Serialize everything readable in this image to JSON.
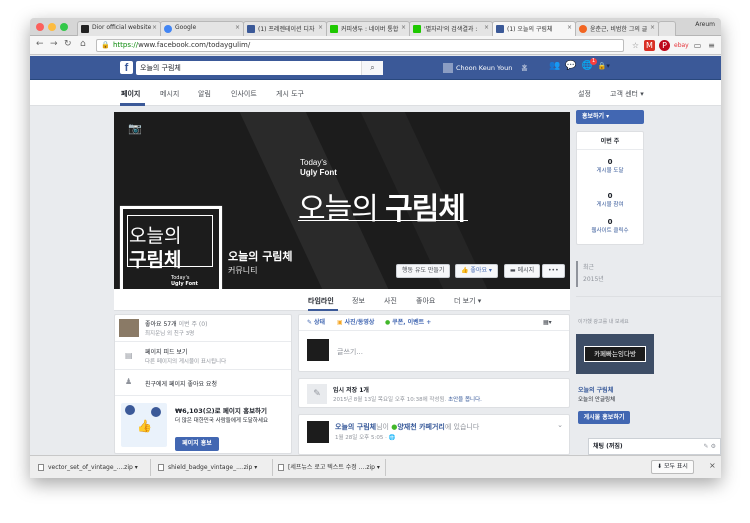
{
  "browser": {
    "tabs": [
      {
        "label": "Dior official website",
        "color": "#222222"
      },
      {
        "label": "Google",
        "color": "#4285f4"
      },
      {
        "label": "(1) 프레젠테이션 디자",
        "color": "#3b5998"
      },
      {
        "label": "커피생두 : 네이버 통합",
        "color": "#1ec800"
      },
      {
        "label": "'별자리'의 검색결과 :",
        "color": "#1ec800"
      },
      {
        "label": "(1) 오늘의 구림체",
        "color": "#3b5998"
      },
      {
        "label": "윤춘근, 비범한 그의 글",
        "color": "#f26522"
      }
    ],
    "profile_name": "Areum",
    "url_scheme": "https://",
    "url_rest": "www.facebook.com/todaygulim/"
  },
  "fb_header": {
    "search_value": "오늘의 구림체",
    "user_name": "Choon Keun Youn",
    "home_label": "홈",
    "notification_count": "1"
  },
  "page_nav": {
    "items": [
      "페이지",
      "메시지",
      "알림",
      "인사이트",
      "게시 도구"
    ],
    "settings": "설정",
    "help": "고객 센터 ▾"
  },
  "cover": {
    "today_line1": "Today's",
    "today_line2": "Ugly Font",
    "title_thin": "오늘의 ",
    "title_bold": "구림체",
    "profile_line1": "오늘의",
    "profile_line2": "구림체",
    "profile_small1": "Today's",
    "profile_small2": "Ugly Font",
    "page_name": "오늘의 구림체",
    "page_category": "커뮤니티",
    "btn_action": "행동 유도 만들기",
    "btn_like": "좋아요 ▾",
    "btn_message": "메시지",
    "btn_more": "•••"
  },
  "timeline_tabs": [
    "타임라인",
    "정보",
    "사진",
    "좋아요",
    "더 보기 ▾"
  ],
  "left_col": {
    "likes_text": "좋아요 57개",
    "likes_week": "이번 주 (0)",
    "likes_sub": "최지운님 외 친구 3명",
    "feed_title": "페이지 피드 보기",
    "feed_sub": "다른 페이지의 게시물이 표시됩니다",
    "invite": "친구에게 페이지 좋아요 요청",
    "promo_title": "₩6,103(으)로 페이지 홍보하기",
    "promo_sub": "더 많은 대한민국 사람들에게 도달하세요",
    "promo_btn": "페이지 홍보"
  },
  "composer": {
    "tab_status": "상태",
    "tab_photo": "사진/동영상",
    "tab_coupon": "쿠폰, 이벤트 +",
    "placeholder": "글쓰기..."
  },
  "draft": {
    "title": "임시 저장 1개",
    "sub_a": "2015년 8월 13일 목요일 오후 10:38에 작성됨.",
    "sub_link": "초안을 봅니다."
  },
  "post": {
    "name": "오늘의 구림체",
    "mid": "님이",
    "place": "양재천 카페거리",
    "tail": "에 있습니다",
    "time": "1월 28일 오후 5:05 · 🌐"
  },
  "right_col": {
    "promote_btn": "홍보하기 ▾",
    "week_label": "이번 주",
    "stats": [
      {
        "value": "0",
        "label": "게시물 도달"
      },
      {
        "value": "0",
        "label": "게시물 참여"
      },
      {
        "value": "0",
        "label": "웹사이트 클릭수"
      }
    ],
    "recent_label": "최근",
    "recent_year": "2015년",
    "ad_title": "이가했 광고를 내 보세요",
    "ad_image_text": "카페빠는잉다방",
    "ad_name": "오늘의 구림체",
    "ad_sub": "오늘의 안글링체",
    "ad_btn": "게시물 홍보하기",
    "chat_label": "채팅 (꺼짐)"
  },
  "downloads": {
    "items": [
      "vector_set_of_vintage_....zip",
      "shield_badge_vintage_....zip",
      "[세프뉴스 로고 텍스트 수정 ....zip"
    ],
    "show_all": "모두 표시"
  }
}
